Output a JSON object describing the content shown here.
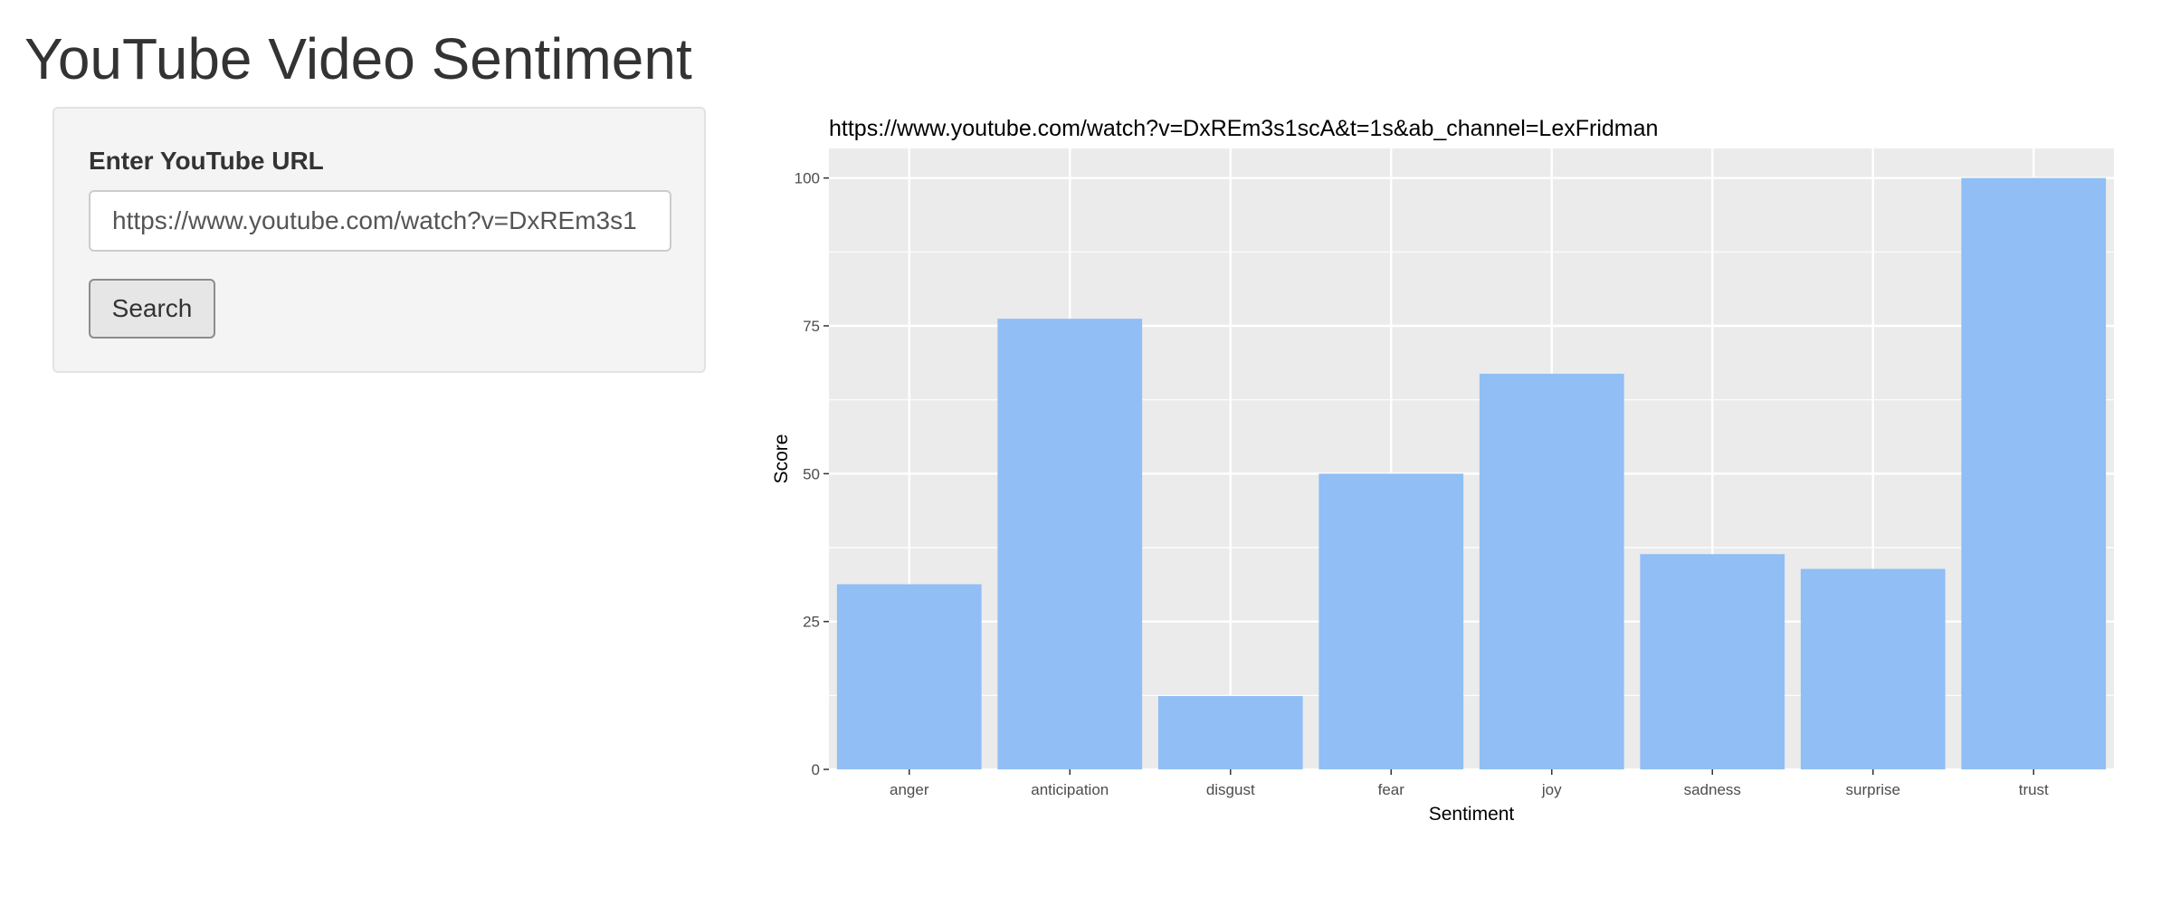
{
  "page": {
    "title": "YouTube Video Sentiment"
  },
  "sidebar": {
    "input_label": "Enter YouTube URL",
    "url_value": "https://www.youtube.com/watch?v=DxREm3s1",
    "search_label": "Search"
  },
  "colors": {
    "bar": "#90BEF5",
    "panel_bg": "#EBEBEB",
    "grid": "#FFFFFF",
    "sidebar_bg": "#F4F4F4"
  },
  "chart_data": {
    "type": "bar",
    "title": "https://www.youtube.com/watch?v=DxREm3s1scA&t=1s&ab_channel=LexFridman",
    "xlabel": "Sentiment",
    "ylabel": "Score",
    "categories": [
      "anger",
      "anticipation",
      "disgust",
      "fear",
      "joy",
      "sadness",
      "surprise",
      "trust"
    ],
    "values": [
      31.3,
      76.2,
      12.4,
      50,
      66.9,
      36.4,
      33.9,
      100
    ],
    "ylim": [
      0,
      105
    ],
    "yticks": [
      0,
      25,
      50,
      75,
      100
    ],
    "grid": true
  }
}
